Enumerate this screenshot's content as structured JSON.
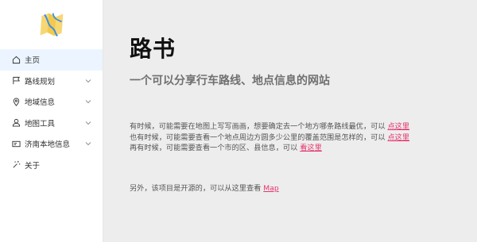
{
  "sidebar": {
    "logo": {
      "icon": "map-logo-icon"
    },
    "items": [
      {
        "label": "主页",
        "icon": "home-icon",
        "active": true,
        "has_submenu": false
      },
      {
        "label": "路线规划",
        "icon": "flag-icon",
        "active": false,
        "has_submenu": true
      },
      {
        "label": "地域信息",
        "icon": "location-icon",
        "active": false,
        "has_submenu": true
      },
      {
        "label": "地图工具",
        "icon": "user-icon",
        "active": false,
        "has_submenu": true
      },
      {
        "label": "济南本地信息",
        "icon": "id-card-icon",
        "active": false,
        "has_submenu": true
      },
      {
        "label": "关于",
        "icon": "magic-stick-icon",
        "active": false,
        "has_submenu": false
      }
    ]
  },
  "main": {
    "title": "路书",
    "subtitle": "一个可以分享行车路线、地点信息的网站",
    "lines": [
      {
        "text": "有时候，可能需要在地图上写写画画，想要确定去一个地方哪条路线最优，可以 ",
        "link": "点这里"
      },
      {
        "text": "也有时候，可能需要查看一个地点周边方圆多少公里的覆盖范围是怎样的，可以 ",
        "link": "点这里"
      },
      {
        "text": "再有时候，可能需要查看一个市的区、县信息，可以 ",
        "link": "看这里"
      }
    ],
    "note": {
      "text": "另外，该项目是开源的，可以从这里查看 ",
      "link": "Map"
    }
  },
  "colors": {
    "accent_link": "#e6336b",
    "active_bg": "#ecf5ff",
    "page_bg": "#ededed",
    "logo_yellow": "#f7d774",
    "logo_blue": "#3a8ee6"
  }
}
